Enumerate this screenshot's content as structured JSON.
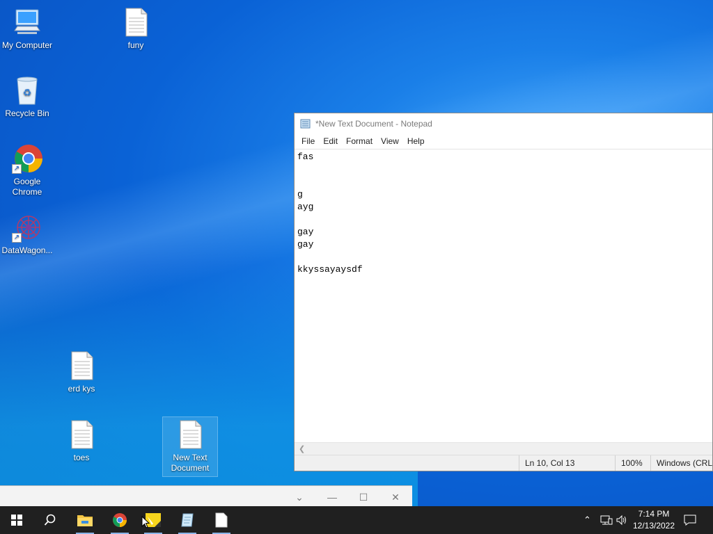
{
  "desktop": {
    "icons": [
      {
        "label": "My Computer"
      },
      {
        "label": "funy"
      },
      {
        "label": "Recycle Bin"
      },
      {
        "label": "Google Chrome"
      },
      {
        "label": "DataWagon..."
      },
      {
        "label": "erd kys"
      },
      {
        "label": "toes"
      },
      {
        "label": "New Text Document"
      }
    ]
  },
  "notepad": {
    "title": "*New Text Document - Notepad",
    "menu": [
      "File",
      "Edit",
      "Format",
      "View",
      "Help"
    ],
    "content": "fas\n\n\ng\nayg\n\ngay\ngay\n\nkkyssayaysdf",
    "status": {
      "position": "Ln 10, Col 13",
      "zoom": "100%",
      "encoding": "Windows (CRLF"
    }
  },
  "taskbar": {
    "clock_time": "7:14 PM",
    "clock_date": "12/13/2022",
    "items": [
      "start-icon",
      "search-icon",
      "file-explorer-icon",
      "chrome-icon",
      "sticky-notes-icon",
      "notepad-icon",
      "text-file-icon"
    ]
  },
  "colors": {
    "taskbar_bg": "#202020",
    "active_indicator": "#8ab4e8"
  }
}
